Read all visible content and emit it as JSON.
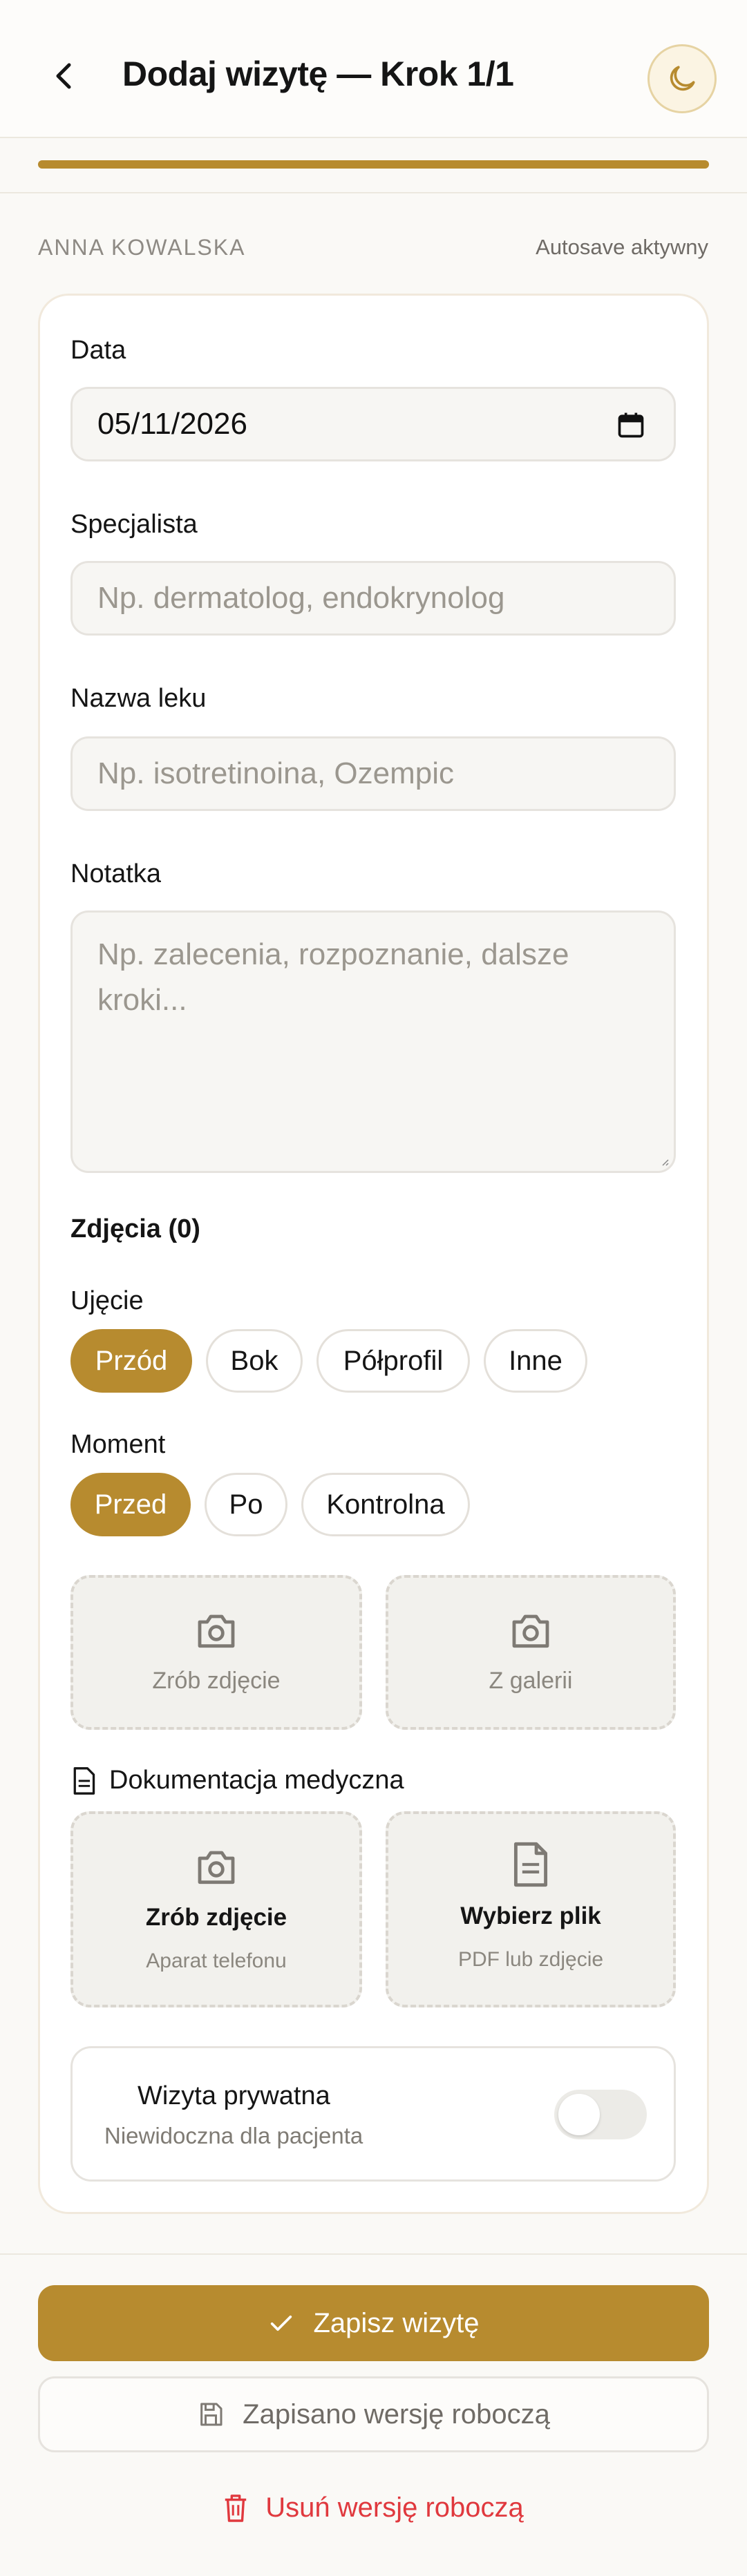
{
  "header": {
    "title": "Dodaj wizytę — Krok 1/1",
    "back_icon": "chevron-left-icon",
    "theme_icon": "moon-icon"
  },
  "progress": {
    "fraction": 1.0
  },
  "patient": {
    "name": "ANNA KOWALSKA",
    "autosave": "Autosave aktywny"
  },
  "form": {
    "date": {
      "label": "Data",
      "value": "05/11/2026",
      "icon": "calendar-icon"
    },
    "specialist": {
      "label": "Specjalista",
      "placeholder": "Np. dermatolog, endokrynolog"
    },
    "drug": {
      "label": "Nazwa leku",
      "placeholder": "Np. isotretinoina, Ozempic"
    },
    "note": {
      "label": "Notatka",
      "placeholder": "Np. zalecenia, rozpoznanie, dalsze kroki..."
    }
  },
  "photos": {
    "heading": "Zdjęcia (0)",
    "angle_label": "Ujęcie",
    "angles": [
      "Przód",
      "Bok",
      "Półprofil",
      "Inne"
    ],
    "angle_selected": "Przód",
    "moment_label": "Moment",
    "moments": [
      "Przed",
      "Po",
      "Kontrolna"
    ],
    "moment_selected": "Przed",
    "take_photo": "Zrób zdjęcie",
    "from_gallery": "Z galerii"
  },
  "medical_docs": {
    "heading": "Dokumentacja medyczna",
    "heading_icon": "document-icon",
    "camera_title": "Zrób zdjęcie",
    "camera_sub": "Aparat telefonu",
    "file_title": "Wybierz plik",
    "file_sub": "PDF lub zdjęcie"
  },
  "private_visit": {
    "title": "Wizyta prywatna",
    "subtitle": "Niewidoczna dla pacjenta",
    "enabled": false
  },
  "actions": {
    "save": "Zapisz wizytę",
    "draft_saved": "Zapisano wersję roboczą",
    "delete_draft": "Usuń wersję roboczą"
  },
  "colors": {
    "accent": "#b78b2f",
    "danger": "#e0393e",
    "background": "#faf9f6"
  }
}
